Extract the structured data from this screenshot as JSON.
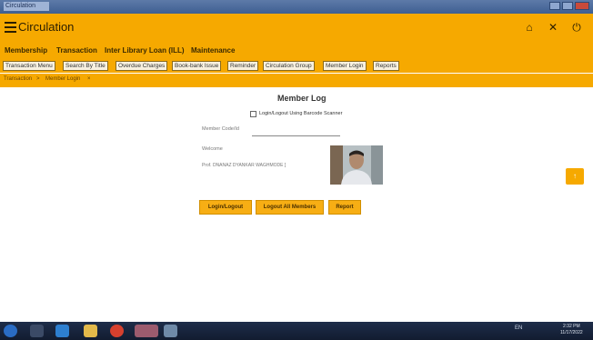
{
  "window": {
    "title": "Circulation"
  },
  "header": {
    "title": "Circulation",
    "icons": [
      "home-icon",
      "close-icon",
      "power-icon"
    ],
    "home_glyph": "⌂",
    "close_glyph": "✕",
    "power_glyph": "⏻"
  },
  "nav": {
    "items": [
      "Membership",
      "Transaction",
      "Inter Library Loan (ILL)",
      "Maintenance"
    ]
  },
  "toolbar": {
    "items": [
      "Transaction Menu",
      "Search By Title",
      "Overdue Charges",
      "Book-bank Issue",
      "Reminder",
      "Circulation Group",
      "Member Login",
      "Reports"
    ]
  },
  "breadcrumb": {
    "parent": "Transaction",
    "sep": ">",
    "current": "Member Login",
    "close": "×"
  },
  "member_log": {
    "title": "Member Log",
    "checkbox_label": "Login/Logout Using Barcode Scanner",
    "checkbox_checked": false,
    "code_label": "Member Code/Id",
    "code_value": "",
    "welcome": "Welcome",
    "member_name": "Prof. DNANAZ DYANKAR WAGHMODE ]",
    "buttons": {
      "login_logout": "Login/Logout",
      "logout_all": "Logout All Members",
      "report": "Report"
    }
  },
  "scroll_up_glyph": "↑",
  "taskbar": {
    "tray_text": "EN",
    "time": "2:32 PM",
    "date": "11/17/2022"
  },
  "colors": {
    "accent": "#f6a900",
    "button": "#f7ae14",
    "taskbar": "#1a2740"
  }
}
